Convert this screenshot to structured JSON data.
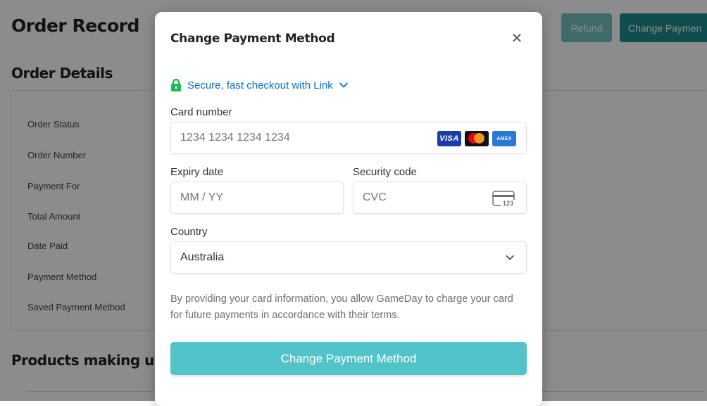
{
  "page": {
    "title": "Order Record",
    "refund_label": "Refund",
    "change_payment_label": "Change Paymen",
    "details_title": "Order Details",
    "detail_labels": [
      "Order Status",
      "Order Number",
      "Payment For",
      "Total Amount",
      "Date Paid",
      "Payment Method",
      "Saved Payment Method"
    ],
    "products_title": "Products making up t"
  },
  "modal": {
    "title": "Change Payment Method",
    "close_icon": "close-icon",
    "link_text": "Secure, fast checkout with Link",
    "card_number": {
      "label": "Card number",
      "placeholder": "1234 1234 1234 1234",
      "brands": [
        "VISA",
        "Mastercard",
        "AMEX"
      ]
    },
    "expiry": {
      "label": "Expiry date",
      "placeholder": "MM / YY"
    },
    "security": {
      "label": "Security code",
      "placeholder": "CVC",
      "icon_text": "123"
    },
    "country": {
      "label": "Country",
      "value": "Australia"
    },
    "consent": "By providing your card information, you allow GameDay to charge your card for future payments in accordance with their terms.",
    "submit_label": "Change Payment Method"
  },
  "colors": {
    "link_blue": "#0a70c8",
    "lock_green": "#1db954",
    "submit_teal": "#52c4c9",
    "page_teal": "#1e8d90"
  }
}
